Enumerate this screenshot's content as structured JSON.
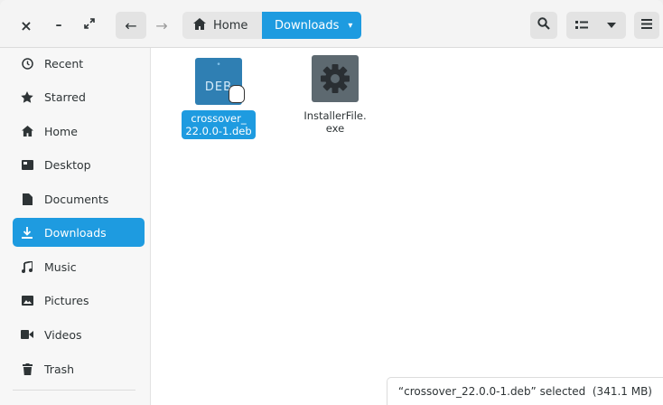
{
  "window": {
    "controls": {
      "close": "×",
      "minimize": "–",
      "maximize": "⤢"
    }
  },
  "nav": {
    "back": "←",
    "forward": "→"
  },
  "pathbar": {
    "home_label": "Home",
    "current_label": "Downloads",
    "current_caret": "▾"
  },
  "toolbar": {
    "search_icon": "search-icon",
    "view_icon": "list-view-icon",
    "sort_icon": "chevron-down-icon",
    "menu_icon": "hamburger-menu-icon"
  },
  "sidebar": {
    "items": [
      {
        "label": "Recent",
        "icon": "clock-icon"
      },
      {
        "label": "Starred",
        "icon": "star-icon"
      },
      {
        "label": "Home",
        "icon": "home-icon"
      },
      {
        "label": "Desktop",
        "icon": "desktop-icon"
      },
      {
        "label": "Documents",
        "icon": "document-icon"
      },
      {
        "label": "Downloads",
        "icon": "download-icon",
        "active": true
      },
      {
        "label": "Music",
        "icon": "music-icon"
      },
      {
        "label": "Pictures",
        "icon": "picture-icon"
      },
      {
        "label": "Videos",
        "icon": "video-icon"
      },
      {
        "label": "Trash",
        "icon": "trash-icon"
      }
    ]
  },
  "files": [
    {
      "name_line1": "crossover_",
      "name_line2": "22.0.0-1.deb",
      "icon": "deb-package-icon",
      "icon_text": "DEB",
      "selected": true
    },
    {
      "name_line1": "InstallerFile.",
      "name_line2": "exe",
      "icon": "gear-icon",
      "selected": false
    }
  ],
  "status": {
    "text": "“crossover_22.0.0-1.deb” selected  (341.1 MB)"
  },
  "colors": {
    "accent": "#1e9be0",
    "deb_icon": "#2f7fb3",
    "exe_icon": "#5d6970"
  }
}
